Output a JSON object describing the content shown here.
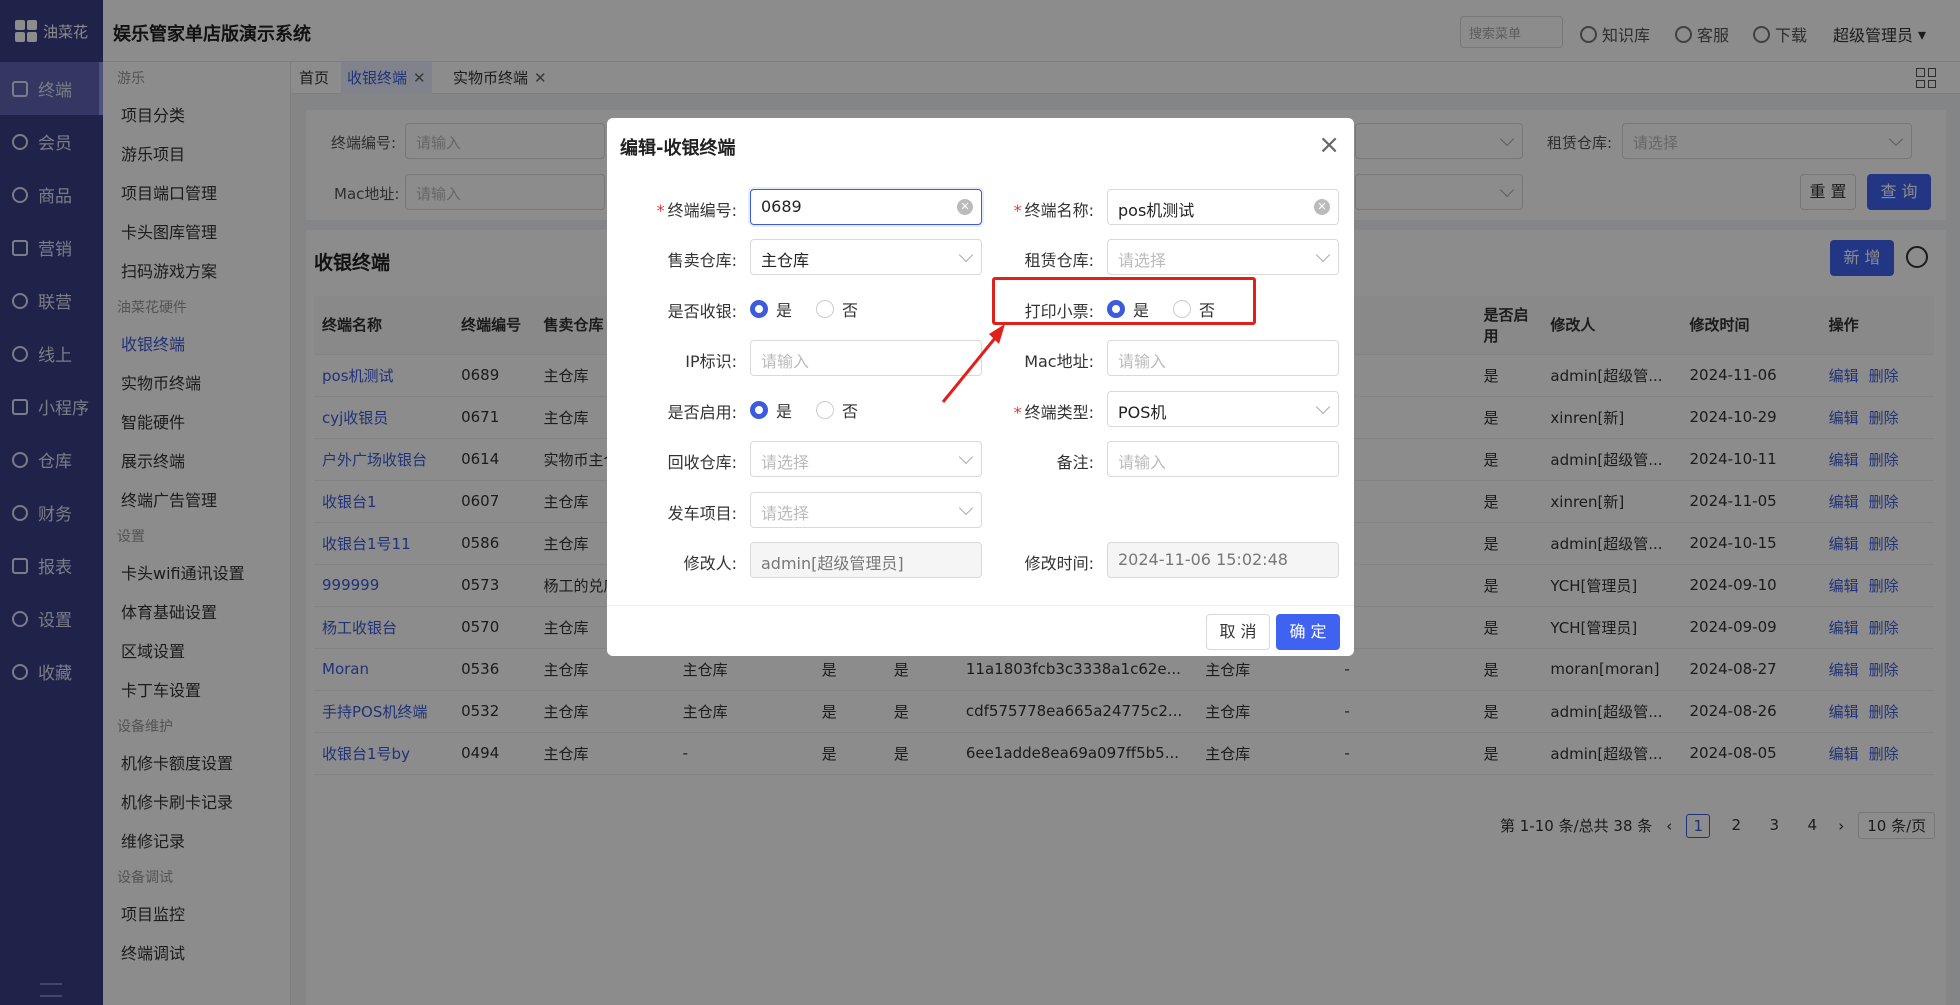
{
  "app": {
    "logo_text": "油菜花",
    "title": "娱乐管家单店版演示系统"
  },
  "header": {
    "search_placeholder": "搜索菜单",
    "links": [
      "知识库",
      "客服",
      "下载"
    ],
    "user": "超级管理员"
  },
  "rail": {
    "items": [
      "终端",
      "会员",
      "商品",
      "营销",
      "联营",
      "线上",
      "小程序",
      "仓库",
      "财务",
      "报表",
      "设置",
      "收藏"
    ],
    "active": "终端"
  },
  "submenu": {
    "groups": [
      {
        "title": "游乐",
        "items": [
          "项目分类",
          "游乐项目",
          "项目端口管理",
          "卡头图库管理",
          "扫码游戏方案"
        ]
      },
      {
        "title": "油菜花硬件",
        "items": [
          "收银终端",
          "实物币终端",
          "智能硬件",
          "展示终端",
          "终端广告管理"
        ]
      },
      {
        "title": "设置",
        "items": [
          "卡头wifi通讯设置",
          "体育基础设置",
          "区域设置",
          "卡丁车设置"
        ]
      },
      {
        "title": "设备维护",
        "items": [
          "机修卡额度设置",
          "机修卡刷卡记录",
          "维修记录"
        ]
      },
      {
        "title": "设备调试",
        "items": [
          "项目监控",
          "终端调试"
        ]
      }
    ],
    "active": "收银终端"
  },
  "tabs": [
    "首页",
    "收银终端",
    "实物币终端"
  ],
  "filter": {
    "terminal_no_label": "终端编号:",
    "terminal_no_ph": "请输入",
    "mac_label": "Mac地址:",
    "mac_ph": "请输入",
    "rent_label": "租赁仓库:",
    "rent_ph": "请选择",
    "reset": "重 置",
    "query": "查 询"
  },
  "table": {
    "title": "收银终端",
    "add_button": "新 增",
    "columns": [
      "终端名称",
      "终端编号",
      "售卖仓库",
      "",
      "",
      "",
      "",
      "",
      "",
      "是否启用",
      "修改人",
      "修改时间",
      "操作"
    ],
    "rows": [
      {
        "name": "pos机测试",
        "no": "0689",
        "wh": "主仓库",
        "c4": "",
        "c5": "",
        "c6": "",
        "mac": "",
        "c8": "",
        "c9": "",
        "enabled": "是",
        "user": "admin[超级管...",
        "time": "2024-11-06"
      },
      {
        "name": "cyj收银员",
        "no": "0671",
        "wh": "主仓库",
        "c4": "",
        "c5": "",
        "c6": "",
        "mac": "",
        "c8": "",
        "c9": "",
        "enabled": "是",
        "user": "xinren[新]",
        "time": "2024-10-29"
      },
      {
        "name": "户外广场收银台",
        "no": "0614",
        "wh": "实物币主仓",
        "c4": "",
        "c5": "",
        "c6": "",
        "mac": "",
        "c8": "",
        "c9": "",
        "enabled": "是",
        "user": "admin[超级管...",
        "time": "2024-10-11"
      },
      {
        "name": "收银台1",
        "no": "0607",
        "wh": "主仓库",
        "c4": "",
        "c5": "",
        "c6": "",
        "mac": "",
        "c8": "",
        "c9": "",
        "enabled": "是",
        "user": "xinren[新]",
        "time": "2024-11-05"
      },
      {
        "name": "收银台1号11",
        "no": "0586",
        "wh": "主仓库",
        "c4": "",
        "c5": "",
        "c6": "",
        "mac": "",
        "c8": "",
        "c9": "",
        "enabled": "是",
        "user": "admin[超级管...",
        "time": "2024-10-15"
      },
      {
        "name": "999999",
        "no": "0573",
        "wh": "杨工的兑库",
        "c4": "",
        "c5": "",
        "c6": "",
        "mac": "",
        "c8": "",
        "c9": "",
        "enabled": "是",
        "user": "YCH[管理员]",
        "time": "2024-09-10"
      },
      {
        "name": "杨工收银台",
        "no": "0570",
        "wh": "主仓库",
        "c4": "",
        "c5": "",
        "c6": "",
        "mac": "",
        "c8": "",
        "c9": "",
        "enabled": "是",
        "user": "YCH[管理员]",
        "time": "2024-09-09"
      },
      {
        "name": "Moran",
        "no": "0536",
        "wh": "主仓库",
        "c4": "主仓库",
        "c5": "是",
        "c6": "是",
        "mac": "11a1803fcb3c3338a1c62e...",
        "c8": "主仓库",
        "c9": "-",
        "enabled": "是",
        "user": "moran[moran]",
        "time": "2024-08-27"
      },
      {
        "name": "手持POS机终端",
        "no": "0532",
        "wh": "主仓库",
        "c4": "主仓库",
        "c5": "是",
        "c6": "是",
        "mac": "cdf575778ea665a24775c2...",
        "c8": "主仓库",
        "c9": "-",
        "enabled": "是",
        "user": "admin[超级管...",
        "time": "2024-08-26"
      },
      {
        "name": "收银台1号by",
        "no": "0494",
        "wh": "主仓库",
        "c4": "-",
        "c5": "是",
        "c6": "是",
        "mac": "6ee1adde8ea69a097ff5b5...",
        "c8": "主仓库",
        "c9": "-",
        "enabled": "是",
        "user": "admin[超级管...",
        "time": "2024-08-05"
      }
    ],
    "op_edit": "编辑",
    "op_delete": "删除"
  },
  "pager": {
    "summary": "第 1-10 条/总共 38 条",
    "pages": [
      "1",
      "2",
      "3",
      "4"
    ],
    "current": "1",
    "size": "10 条/页"
  },
  "modal": {
    "title": "编辑-收银终端",
    "fields": {
      "terminal_no": {
        "label": "终端编号:",
        "value": "0689"
      },
      "terminal_name": {
        "label": "终端名称:",
        "value": "pos机测试"
      },
      "sell_wh": {
        "label": "售卖仓库:",
        "value": "主仓库"
      },
      "rent_wh": {
        "label": "租赁仓库:",
        "placeholder": "请选择"
      },
      "is_cashier": {
        "label": "是否收银:",
        "yes": "是",
        "no": "否",
        "selected": "是"
      },
      "print_ticket": {
        "label": "打印小票:",
        "yes": "是",
        "no": "否",
        "selected": "是"
      },
      "ip": {
        "label": "IP标识:",
        "placeholder": "请输入"
      },
      "mac": {
        "label": "Mac地址:",
        "placeholder": "请输入"
      },
      "is_enabled": {
        "label": "是否启用:",
        "yes": "是",
        "no": "否",
        "selected": "是"
      },
      "terminal_type": {
        "label": "终端类型:",
        "value": "POS机"
      },
      "recycle_wh": {
        "label": "回收仓库:",
        "placeholder": "请选择"
      },
      "remark": {
        "label": "备注:",
        "placeholder": "请输入"
      },
      "car_project": {
        "label": "发车项目:",
        "placeholder": "请选择"
      },
      "modifier": {
        "label": "修改人:",
        "value": "admin[超级管理员]"
      },
      "modify_time": {
        "label": "修改时间:",
        "value": "2024-11-06 15:02:48"
      }
    },
    "cancel": "取 消",
    "confirm": "确 定"
  },
  "colors": {
    "primary": "#3f63f0",
    "rail": "#3a3f86",
    "highlight": "#e0201b"
  }
}
